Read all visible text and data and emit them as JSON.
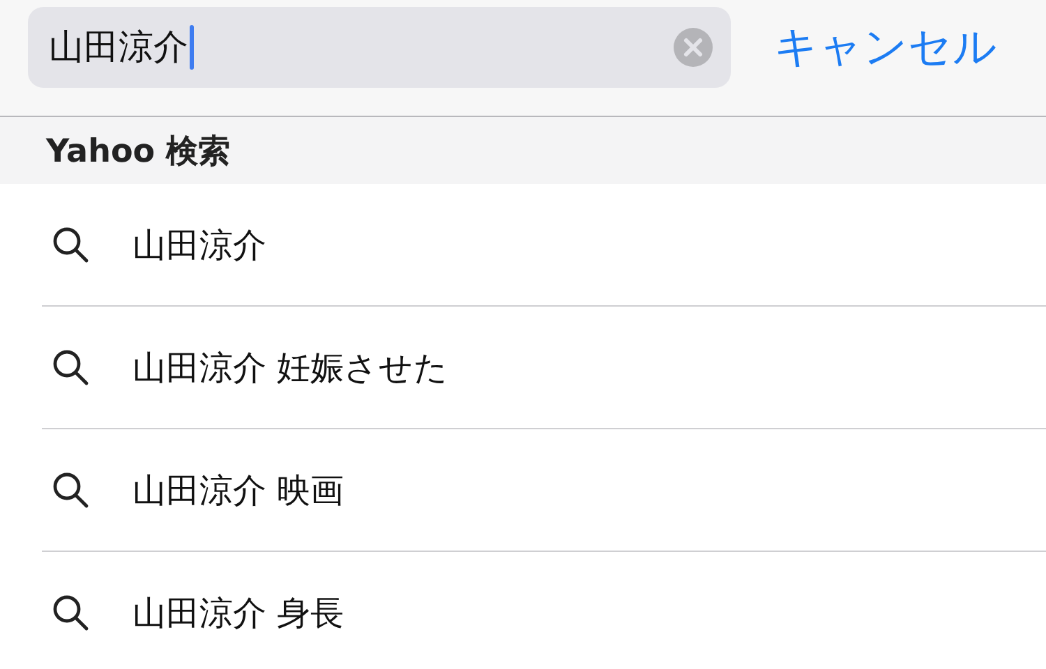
{
  "search": {
    "value": "山田涼介",
    "cancel": "キャンセル"
  },
  "section": {
    "title": "Yahoo 検索"
  },
  "suggestions": [
    {
      "text": "山田涼介"
    },
    {
      "text": "山田涼介 妊娠させた"
    },
    {
      "text": "山田涼介 映画"
    },
    {
      "text": "山田涼介 身長"
    }
  ]
}
